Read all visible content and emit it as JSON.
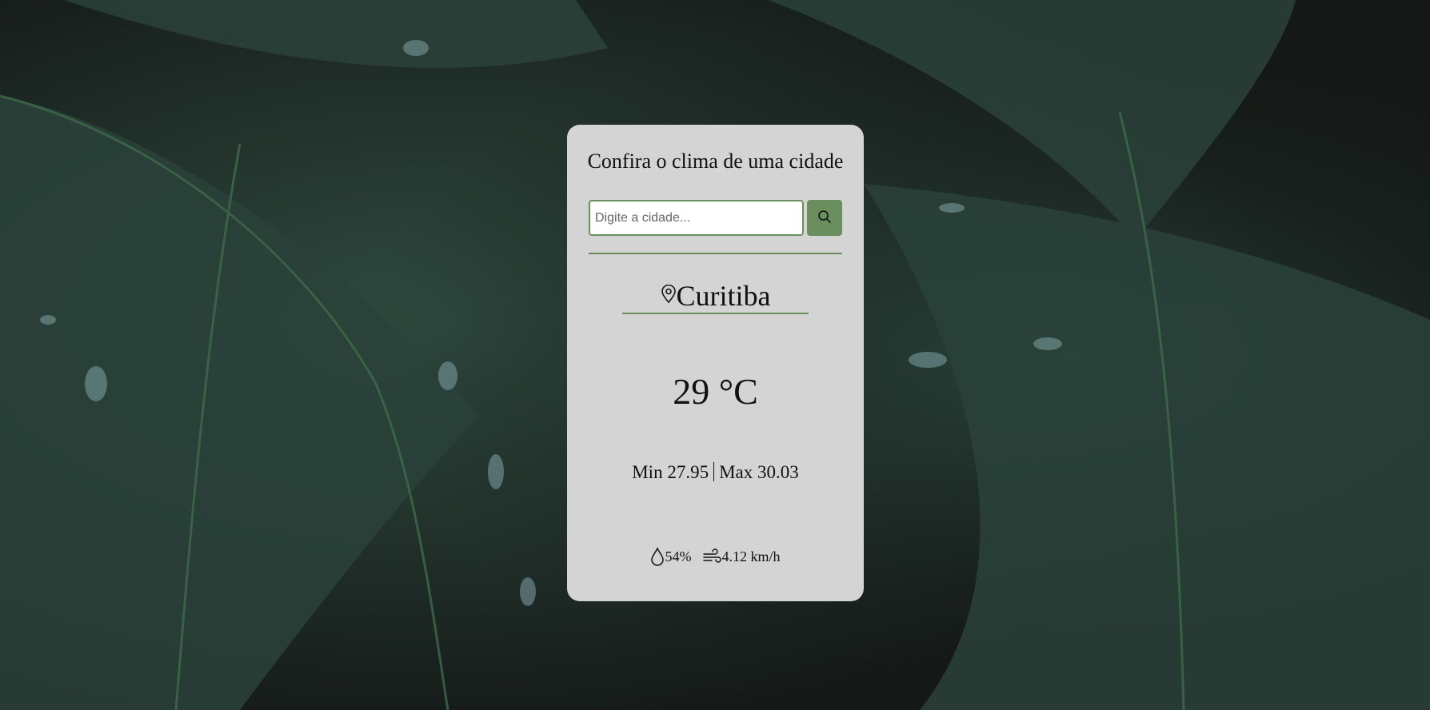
{
  "app": {
    "title": "Confira o clima de uma cidade"
  },
  "search": {
    "placeholder": "Digite a cidade...",
    "value": "",
    "button_icon": "search-icon"
  },
  "weather": {
    "city": "Curitiba",
    "city_icon": "location-pin-icon",
    "temperature": "29 °C",
    "min_text": "Min 27.95",
    "max_text": "Max 30.03",
    "humidity": "54%",
    "humidity_icon": "droplet-icon",
    "wind": "4.12 km/h",
    "wind_icon": "wind-icon"
  },
  "theme": {
    "accent": "#6a8e5e",
    "card_background": "#d4d4d4",
    "page_background": "#141816"
  }
}
